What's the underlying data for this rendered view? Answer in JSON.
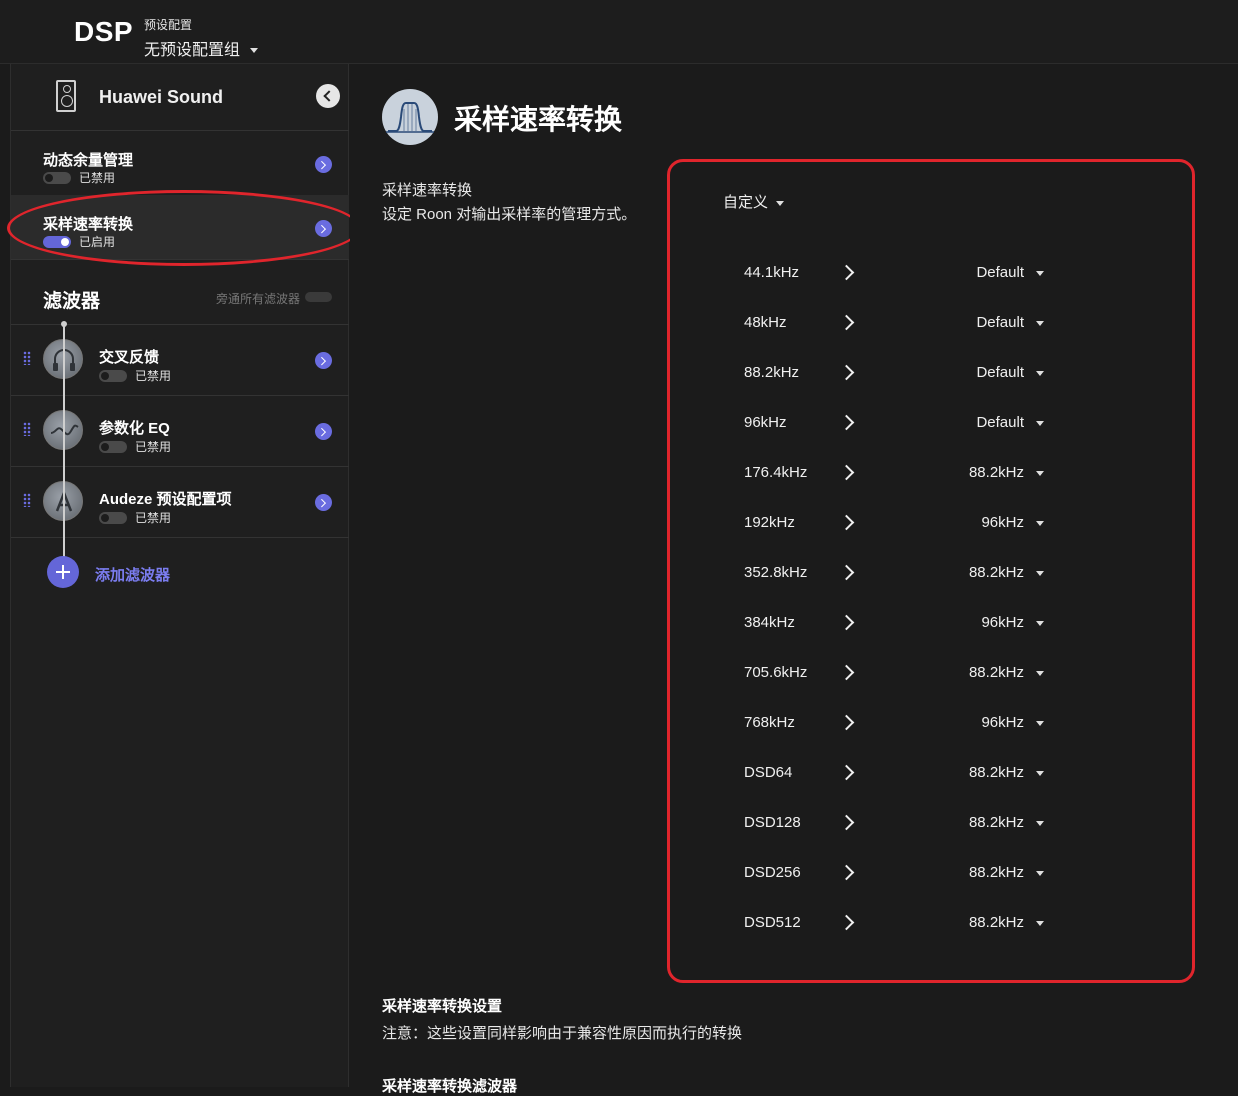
{
  "header": {
    "title": "DSP",
    "preset_label": "预设配置",
    "preset_value": "无预设配置组"
  },
  "sidebar": {
    "device_name": "Huawei Sound",
    "items": [
      {
        "title": "动态余量管理",
        "status": "已禁用",
        "enabled": false
      },
      {
        "title": "采样速率转换",
        "status": "已启用",
        "enabled": true
      }
    ],
    "filters_heading": "滤波器",
    "bypass_label": "旁通所有滤波器",
    "filters": [
      {
        "title": "交叉反馈",
        "status": "已禁用",
        "icon": "crossfeed-headphones-icon"
      },
      {
        "title": "参数化 EQ",
        "status": "已禁用",
        "icon": "parametric-eq-curve-icon"
      },
      {
        "title": "Audeze 预设配置项",
        "status": "已禁用",
        "icon": "audeze-logo-icon"
      }
    ],
    "add_filter_label": "添加滤波器"
  },
  "main": {
    "title": "采样速率转换",
    "description_title": "采样速率转换",
    "description": "设定 Roon 对输出采样率的管理方式。",
    "mode": "自定义",
    "rates": [
      {
        "input": "44.1kHz",
        "output": "Default"
      },
      {
        "input": "48kHz",
        "output": "Default"
      },
      {
        "input": "88.2kHz",
        "output": "Default"
      },
      {
        "input": "96kHz",
        "output": "Default"
      },
      {
        "input": "176.4kHz",
        "output": "88.2kHz"
      },
      {
        "input": "192kHz",
        "output": "96kHz"
      },
      {
        "input": "352.8kHz",
        "output": "88.2kHz"
      },
      {
        "input": "384kHz",
        "output": "96kHz"
      },
      {
        "input": "705.6kHz",
        "output": "88.2kHz"
      },
      {
        "input": "768kHz",
        "output": "96kHz"
      },
      {
        "input": "DSD64",
        "output": "88.2kHz"
      },
      {
        "input": "DSD128",
        "output": "88.2kHz"
      },
      {
        "input": "DSD256",
        "output": "88.2kHz"
      },
      {
        "input": "DSD512",
        "output": "88.2kHz"
      }
    ],
    "settings_title": "采样速率转换设置",
    "settings_note": "注意：这些设置同样影响由于兼容性原因而执行的转换",
    "filter_title": "采样速率转换滤波器"
  },
  "colors": {
    "accent": "#6466d8",
    "highlight_annotation": "#e0252c",
    "background": "#1b1b1b"
  }
}
